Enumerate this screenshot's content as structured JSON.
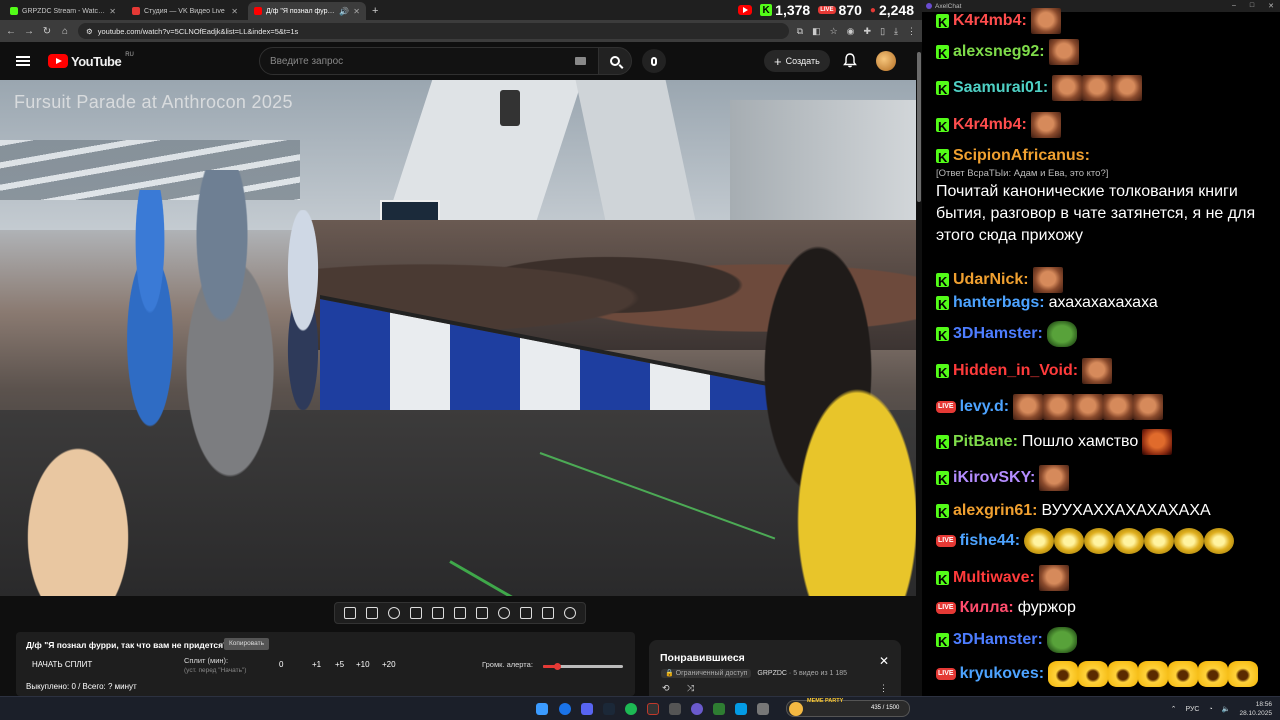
{
  "browser": {
    "tabs": [
      {
        "title": "GRPZDC Stream - Watch Live o",
        "favicon_color": "#53fc18",
        "active": false
      },
      {
        "title": "Студия — VK Видео Live",
        "favicon_color": "#e53935",
        "active": false
      },
      {
        "title": "Д/ф \"Я познал фурри, так",
        "favicon_color": "#ff0000",
        "active": true
      }
    ],
    "url": "youtube.com/watch?v=5CLNOfEadjk&list=LL&index=5&t=1s",
    "viewer_stats": {
      "kick": "1,378",
      "vk": "870",
      "youtube": "2,248"
    }
  },
  "youtube": {
    "logo_text": "YouTube",
    "logo_region": "RU",
    "search_placeholder": "Введите запрос",
    "create_label": "Создать",
    "video_overlay_title": "Fursuit Parade at Anthrocon 2025"
  },
  "alert_panel": {
    "title": "Д/ф \"Я познал фурри, так что вам не придется\"",
    "copy_label": "Копировать",
    "start_label": "НАЧАТЬ СПЛИТ",
    "split_label": "Сплит (мин):",
    "split_hint": "(уст. перед \"Начать\")",
    "split_value": "0",
    "buttons": [
      "+1",
      "+5",
      "+10",
      "+20"
    ],
    "volume_label": "Громк. алерта:",
    "volume_level": 0.18,
    "bought_text": "Выкуплено: 0 / Всего: ? минут"
  },
  "playlist": {
    "title": "Понравившиеся",
    "access": "Ограниченный доступ",
    "owner": "GRPZDC",
    "position": "· 5 видео из 1 185"
  },
  "chat": {
    "window_title": "AxelChat",
    "messages": [
      {
        "platform": "kick",
        "nick": "K4r4mb4:",
        "color": "#ff4d4d",
        "text": "",
        "emotes": [
          "guy"
        ]
      },
      {
        "platform": "kick",
        "nick": "alexsneg92:",
        "color": "#7fdc4a",
        "text": "",
        "emotes": [
          "guy"
        ]
      },
      {
        "platform": "kick",
        "nick": "Saamurai01:",
        "color": "#4fd1c5",
        "text": "",
        "emotes": [
          "guy",
          "guy",
          "guy"
        ]
      },
      {
        "platform": "kick",
        "nick": "K4r4mb4:",
        "color": "#ff4d4d",
        "text": "",
        "emotes": [
          "guy"
        ]
      },
      {
        "platform": "kick",
        "nick": "ScipionAfricanus:",
        "color": "#f0a030",
        "reply": "[Ответ ВсраТЫи: Адам и Ева, это кто?]",
        "text": "Почитай канонические толкования книги бытия, разговор в чате затянется, я не для этого сюда прихожу",
        "emotes": []
      },
      {
        "platform": "kick",
        "nick": "UdarNick:",
        "color": "#f0a030",
        "text": "",
        "emotes": [
          "guy"
        ]
      },
      {
        "platform": "kick",
        "nick": "hanterbags:",
        "color": "#4da3ff",
        "text": "ахахахахахаха",
        "emotes": []
      },
      {
        "platform": "kick",
        "nick": "3DHamster:",
        "color": "#4d7dff",
        "text": "",
        "emotes": [
          "frog"
        ]
      },
      {
        "platform": "kick",
        "nick": "Hidden_in_Void:",
        "color": "#ff3b3b",
        "text": "",
        "emotes": [
          "guy"
        ]
      },
      {
        "platform": "vk",
        "nick": "levy.d:",
        "color": "#4da3ff",
        "text": "",
        "emotes": [
          "guy",
          "guy",
          "guy",
          "guy",
          "guy"
        ]
      },
      {
        "platform": "kick",
        "nick": "PitBane:",
        "color": "#7fdc4a",
        "text": "Пошло хамство",
        "emotes": [
          "angry"
        ]
      },
      {
        "platform": "kick",
        "nick": "iKirovSKY:",
        "color": "#b48cff",
        "text": "",
        "emotes": [
          "guy"
        ]
      },
      {
        "platform": "kick",
        "nick": "alexgrin61:",
        "color": "#f0a030",
        "text": "ВУУХАХХАХАХАХАХА",
        "emotes": []
      },
      {
        "platform": "vk",
        "nick": "fishe44:",
        "color": "#4da3ff",
        "text": "",
        "emotes": [
          "gold",
          "gold",
          "gold",
          "gold",
          "gold",
          "gold",
          "gold"
        ]
      },
      {
        "platform": "kick",
        "nick": "Multiwave:",
        "color": "#ff3b3b",
        "text": "",
        "emotes": [
          "guy"
        ]
      },
      {
        "platform": "vk",
        "nick": "Килла:",
        "color": "#ff4d6d",
        "text": "фуржор",
        "emotes": []
      },
      {
        "platform": "kick",
        "nick": "3DHamster:",
        "color": "#4d7dff",
        "text": "",
        "emotes": [
          "frog"
        ]
      },
      {
        "platform": "vk",
        "nick": "kryukoves:",
        "color": "#4da3ff",
        "text": "",
        "emotes": [
          "laugh",
          "laugh",
          "laugh",
          "laugh",
          "laugh",
          "laugh",
          "laugh"
        ]
      }
    ]
  },
  "taskbar": {
    "widget_label": "MEME PARTY",
    "widget_count": "435 / 1500",
    "lang": "РУС",
    "time": "18:56",
    "date": "28.10.2025"
  }
}
